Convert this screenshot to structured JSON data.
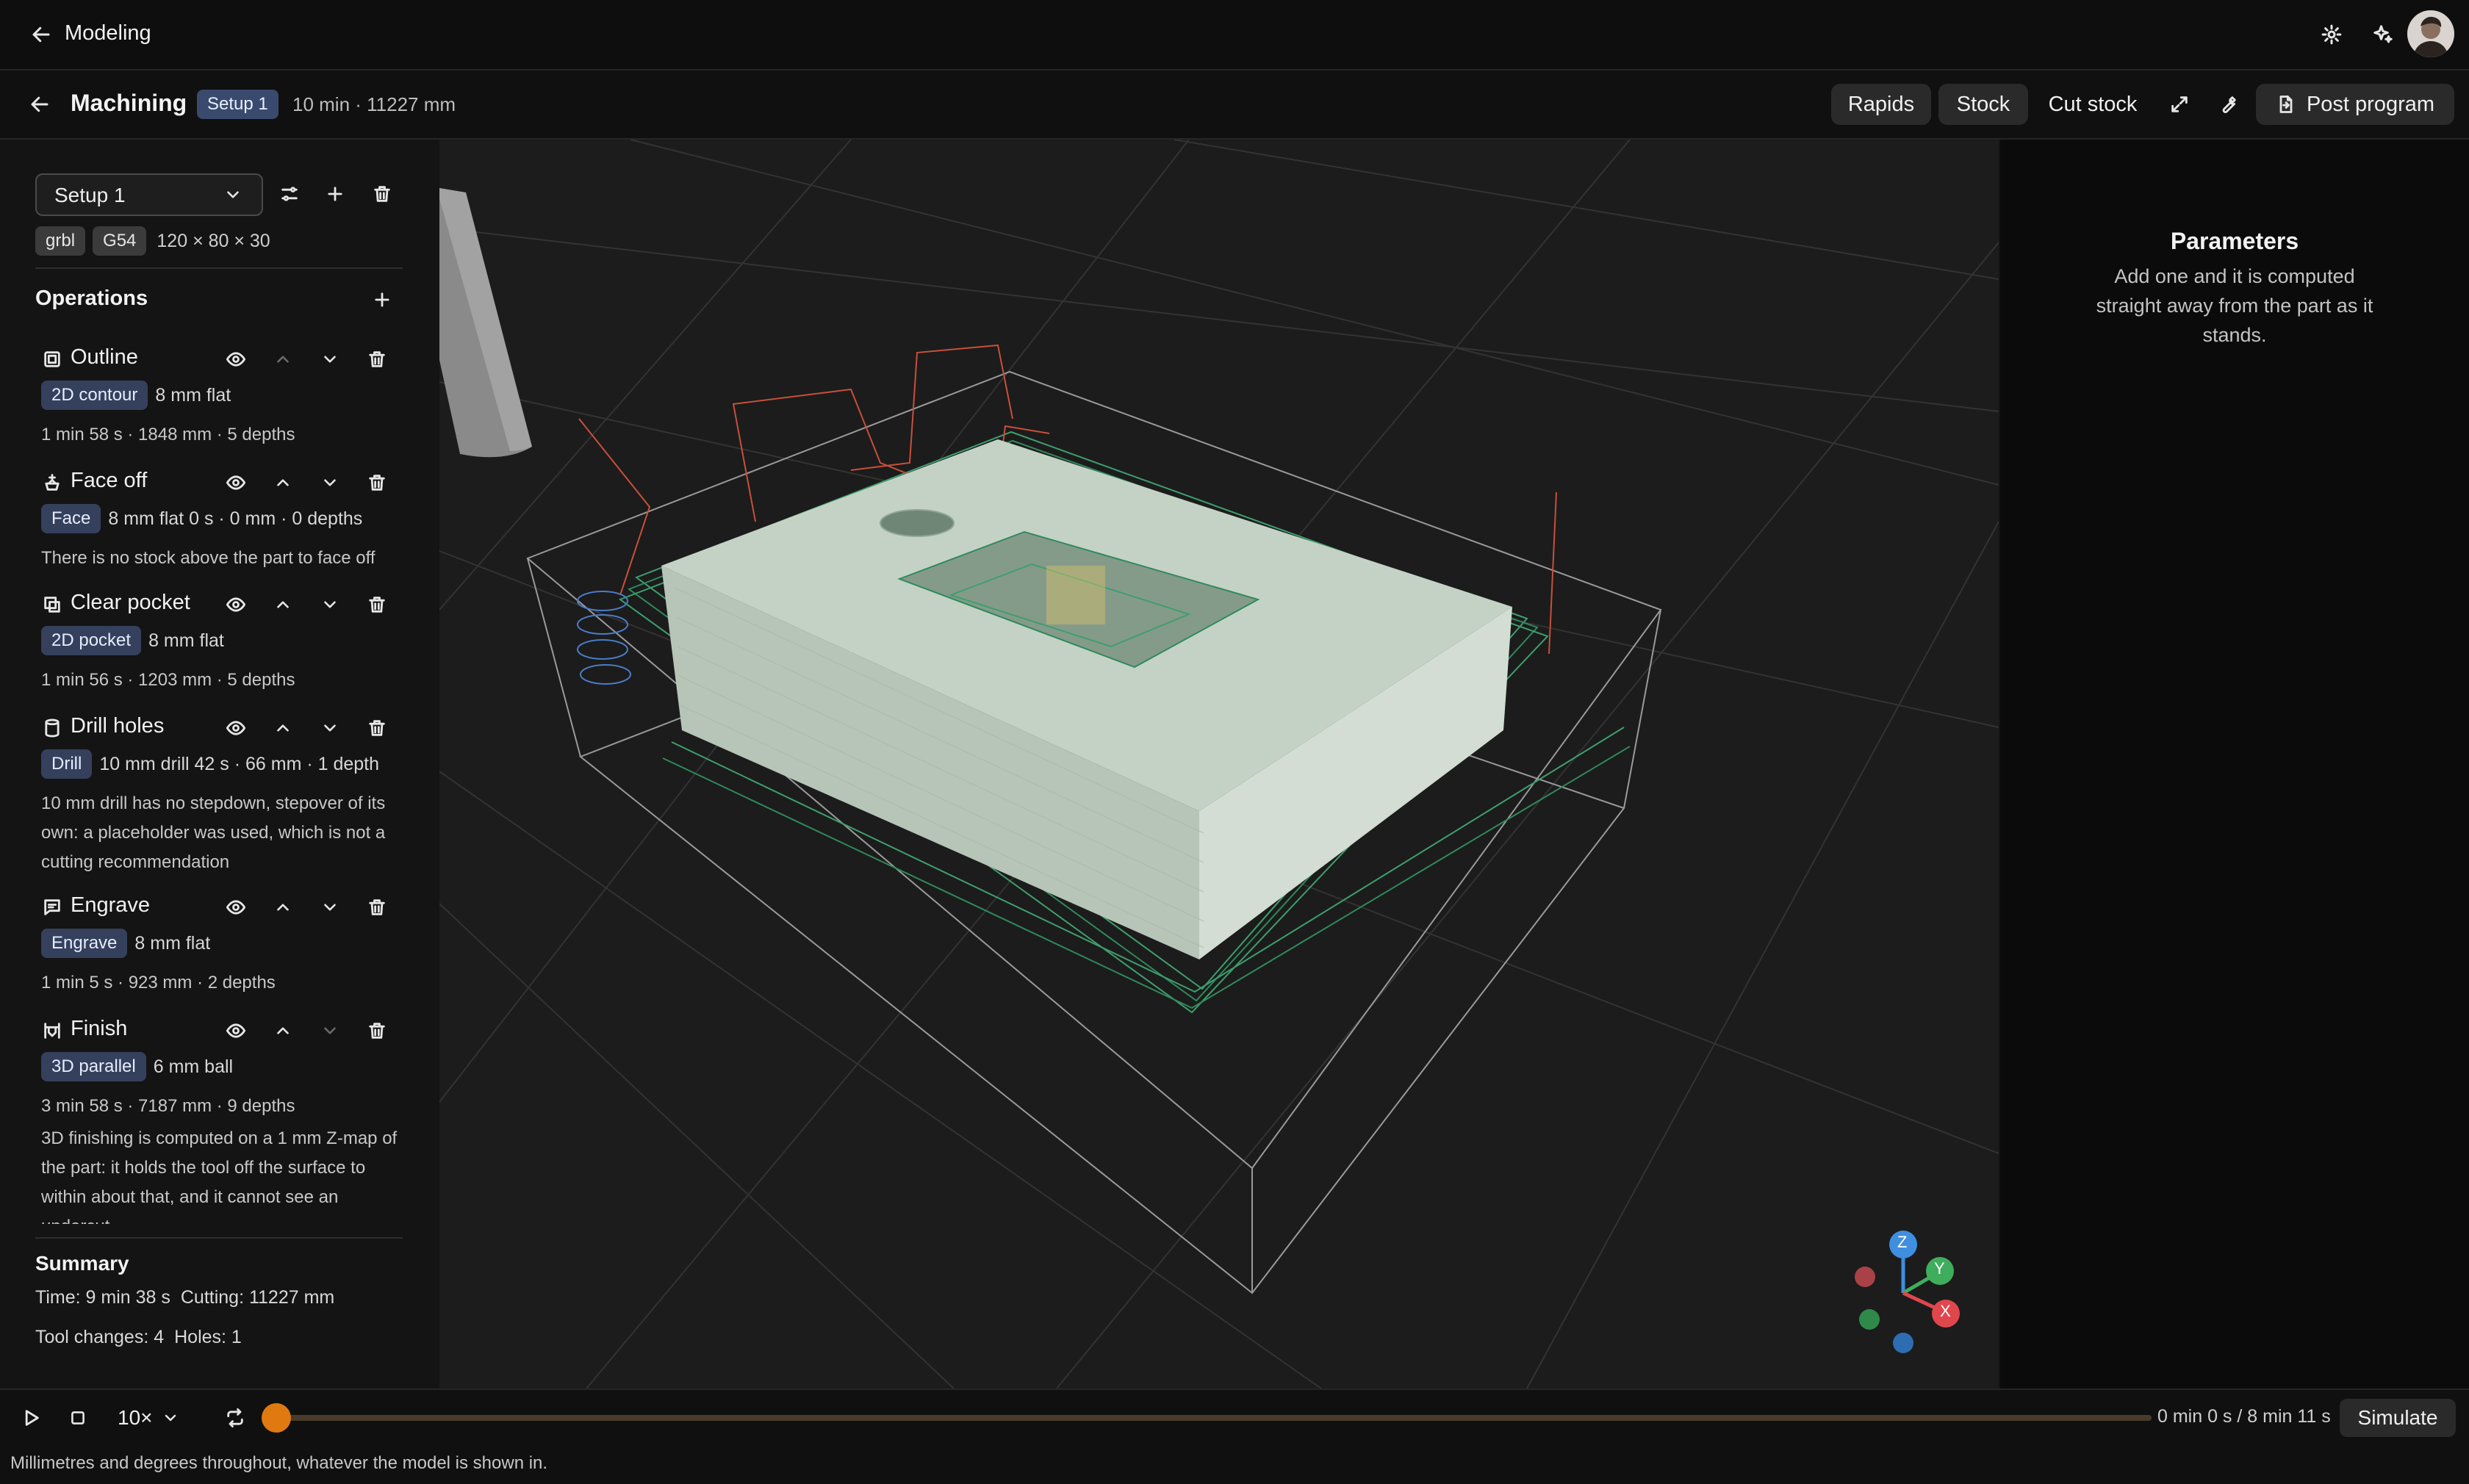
{
  "app": {
    "back_label": "Modeling"
  },
  "toolbar": {
    "title": "Machining",
    "setup_badge": "Setup 1",
    "summary": "10 min · 11227 mm",
    "rapids_label": "Rapids",
    "stock_label": "Stock",
    "cut_stock_label": "Cut stock",
    "post_program_label": "Post program"
  },
  "sidebar": {
    "setup_select": "Setup 1",
    "machine_tag": "grbl",
    "wcs_tag": "G54",
    "stock_size": "120 × 80 × 30",
    "operations_heading": "Operations",
    "operations": [
      {
        "name": "Outline",
        "icon": "outline-icon",
        "type": "2D contour",
        "tool": "8 mm flat",
        "stats": "1 min 58 s · 1848 mm · 5 depths",
        "note": ""
      },
      {
        "name": "Face off",
        "icon": "face-icon",
        "type": "Face",
        "tool": "8 mm flat 0 s · 0 mm · 0 depths",
        "stats": "",
        "note": "There is no stock above the part to face off"
      },
      {
        "name": "Clear pocket",
        "icon": "pocket-icon",
        "type": "2D pocket",
        "tool": "8 mm flat",
        "stats": "1 min 56 s · 1203 mm · 5 depths",
        "note": ""
      },
      {
        "name": "Drill holes",
        "icon": "drill-icon",
        "type": "Drill",
        "tool": "10 mm drill 42 s · 66 mm · 1 depth",
        "stats": "",
        "note": "10 mm drill has no stepdown, stepover of its own: a placeholder was used, which is not a cutting recommendation"
      },
      {
        "name": "Engrave",
        "icon": "engrave-icon",
        "type": "Engrave",
        "tool": "8 mm flat",
        "stats": "1 min 5 s · 923 mm · 2 depths",
        "note": ""
      },
      {
        "name": "Finish",
        "icon": "finish-icon",
        "type": "3D parallel",
        "tool": "6 mm ball",
        "stats": "3 min 58 s · 7187 mm · 9 depths",
        "note": "3D finishing is computed on a 1 mm Z-map of the part: it holds the tool off the surface to within about that, and it cannot see an undercut"
      }
    ],
    "summary_heading": "Summary",
    "summary_time": "Time: 9 min 38 s",
    "summary_cutting": "Cutting: 11227 mm",
    "summary_tool_changes": "Tool changes: 4",
    "summary_holes": "Holes: 1"
  },
  "parameters": {
    "heading": "Parameters",
    "body": "Add one and it is computed straight away from the part as it stands."
  },
  "gizmo": {
    "z": "Z",
    "y": "Y",
    "x": "X",
    "colors": {
      "x": "#e0474c",
      "y": "#3fae5c",
      "z": "#3f8ee0"
    }
  },
  "playback": {
    "speed": "10×",
    "progress": 0.0,
    "time_readout": "0 min 0 s / 8 min 11 s",
    "simulate_label": "Simulate",
    "accent": "#e07a10"
  },
  "status": {
    "units_note": "Millimetres and degrees throughout, whatever the model is shown in."
  }
}
